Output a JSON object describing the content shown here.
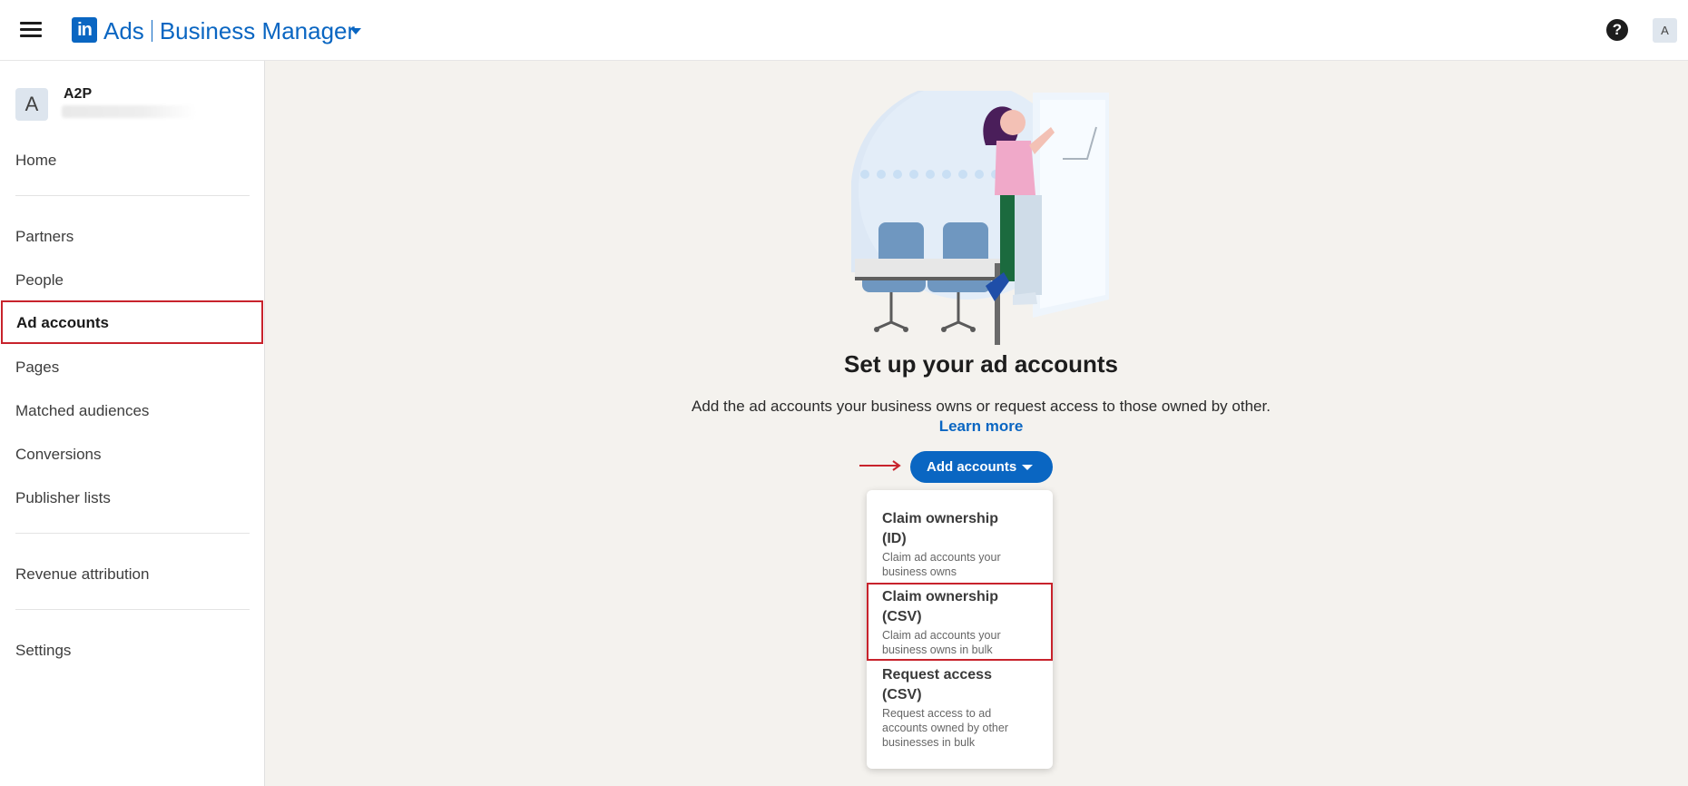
{
  "header": {
    "logo_text": "in",
    "product": "Ads",
    "app_name": "Business Manager",
    "help_symbol": "?",
    "user_initial": "A"
  },
  "sidebar": {
    "account": {
      "initial": "A",
      "name": "A2P"
    },
    "items": [
      {
        "label": "Home"
      },
      {
        "label": "Partners"
      },
      {
        "label": "People"
      },
      {
        "label": "Ad accounts",
        "active": true
      },
      {
        "label": "Pages"
      },
      {
        "label": "Matched audiences"
      },
      {
        "label": "Conversions"
      },
      {
        "label": "Publisher lists"
      },
      {
        "label": "Revenue attribution"
      },
      {
        "label": "Settings"
      }
    ]
  },
  "main": {
    "title": "Set up your ad accounts",
    "description": "Add the ad accounts your business owns or request access to those owned by other.",
    "learn_more": "Learn more",
    "add_button": "Add accounts"
  },
  "dropdown": {
    "items": [
      {
        "title_1": "Claim ownership",
        "title_2": "(ID)",
        "desc_1": "Claim ad accounts your",
        "desc_2": "business owns"
      },
      {
        "title_1": "Claim ownership",
        "title_2": "(CSV)",
        "desc_1": "Claim ad accounts your",
        "desc_2": "business owns in bulk",
        "highlighted": true
      },
      {
        "title_1": "Request access",
        "title_2": "(CSV)",
        "desc_1": "Request access to ad",
        "desc_2": "accounts owned by other",
        "desc_3": "businesses in bulk"
      }
    ]
  },
  "colors": {
    "brand": "#0a66c2",
    "highlight": "#c8232c",
    "background": "#f4f2ee"
  },
  "icons": [
    "hamburger-icon",
    "linkedin-logo-icon",
    "caret-down-icon",
    "help-icon",
    "arrow-right-icon"
  ]
}
